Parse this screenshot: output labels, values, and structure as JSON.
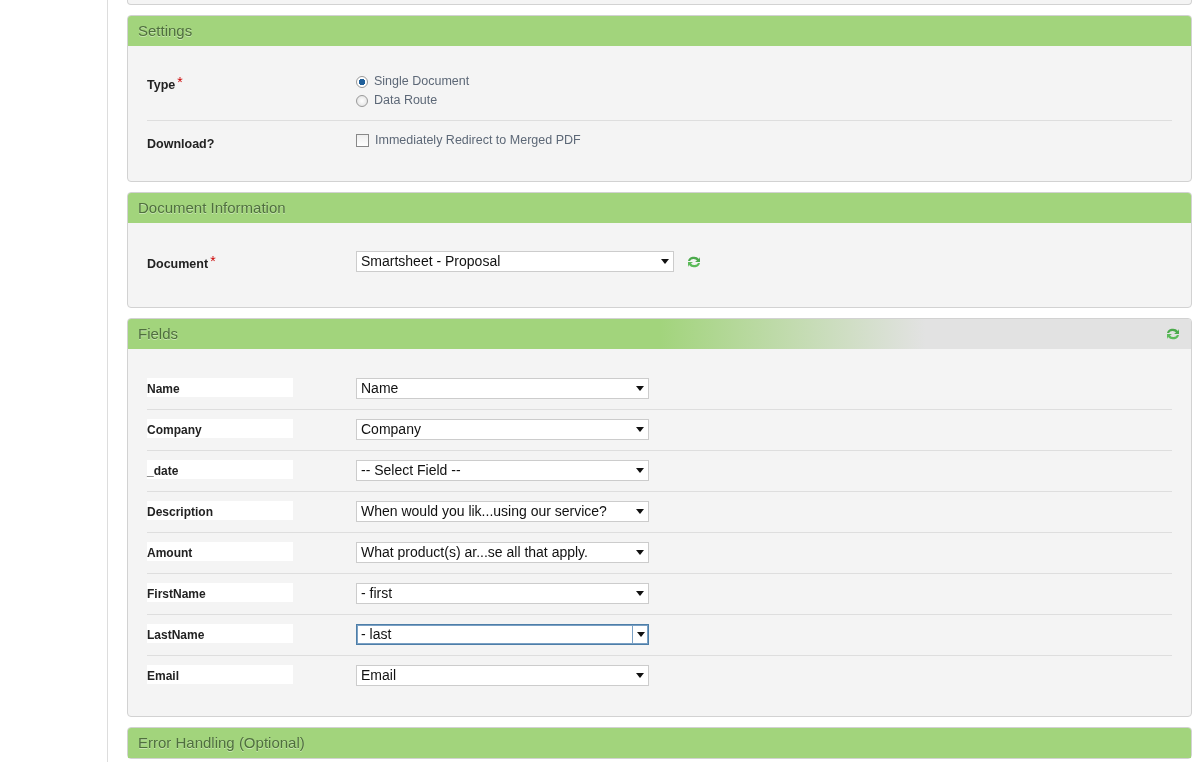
{
  "settings": {
    "title": "Settings",
    "type_field": {
      "label": "Type",
      "required_mark": "*",
      "options": [
        {
          "label": "Single Document",
          "selected": true
        },
        {
          "label": "Data Route",
          "selected": false
        }
      ]
    },
    "download": {
      "label": "Download?",
      "option": {
        "label": "Immediately Redirect to Merged PDF",
        "checked": false
      }
    }
  },
  "document_information": {
    "title": "Document Information",
    "document": {
      "label": "Document",
      "required_mark": "*",
      "value": "Smartsheet - Proposal"
    }
  },
  "fields": {
    "title": "Fields",
    "rows": [
      {
        "label": "Name",
        "value": "Name",
        "focused": false
      },
      {
        "label": "Company",
        "value": "Company",
        "focused": false
      },
      {
        "label": "_date",
        "value": "-- Select Field --",
        "focused": false
      },
      {
        "label": "Description",
        "value": "When would you lik...using our service?",
        "focused": false
      },
      {
        "label": "Amount",
        "value": "What product(s) ar...se all that apply.",
        "focused": false
      },
      {
        "label": "FirstName",
        "value": "- first",
        "focused": false
      },
      {
        "label": "LastName",
        "value": "- last",
        "focused": true
      },
      {
        "label": "Email",
        "value": "Email",
        "focused": false
      }
    ]
  },
  "error_handling": {
    "title": "Error Handling (Optional)"
  }
}
